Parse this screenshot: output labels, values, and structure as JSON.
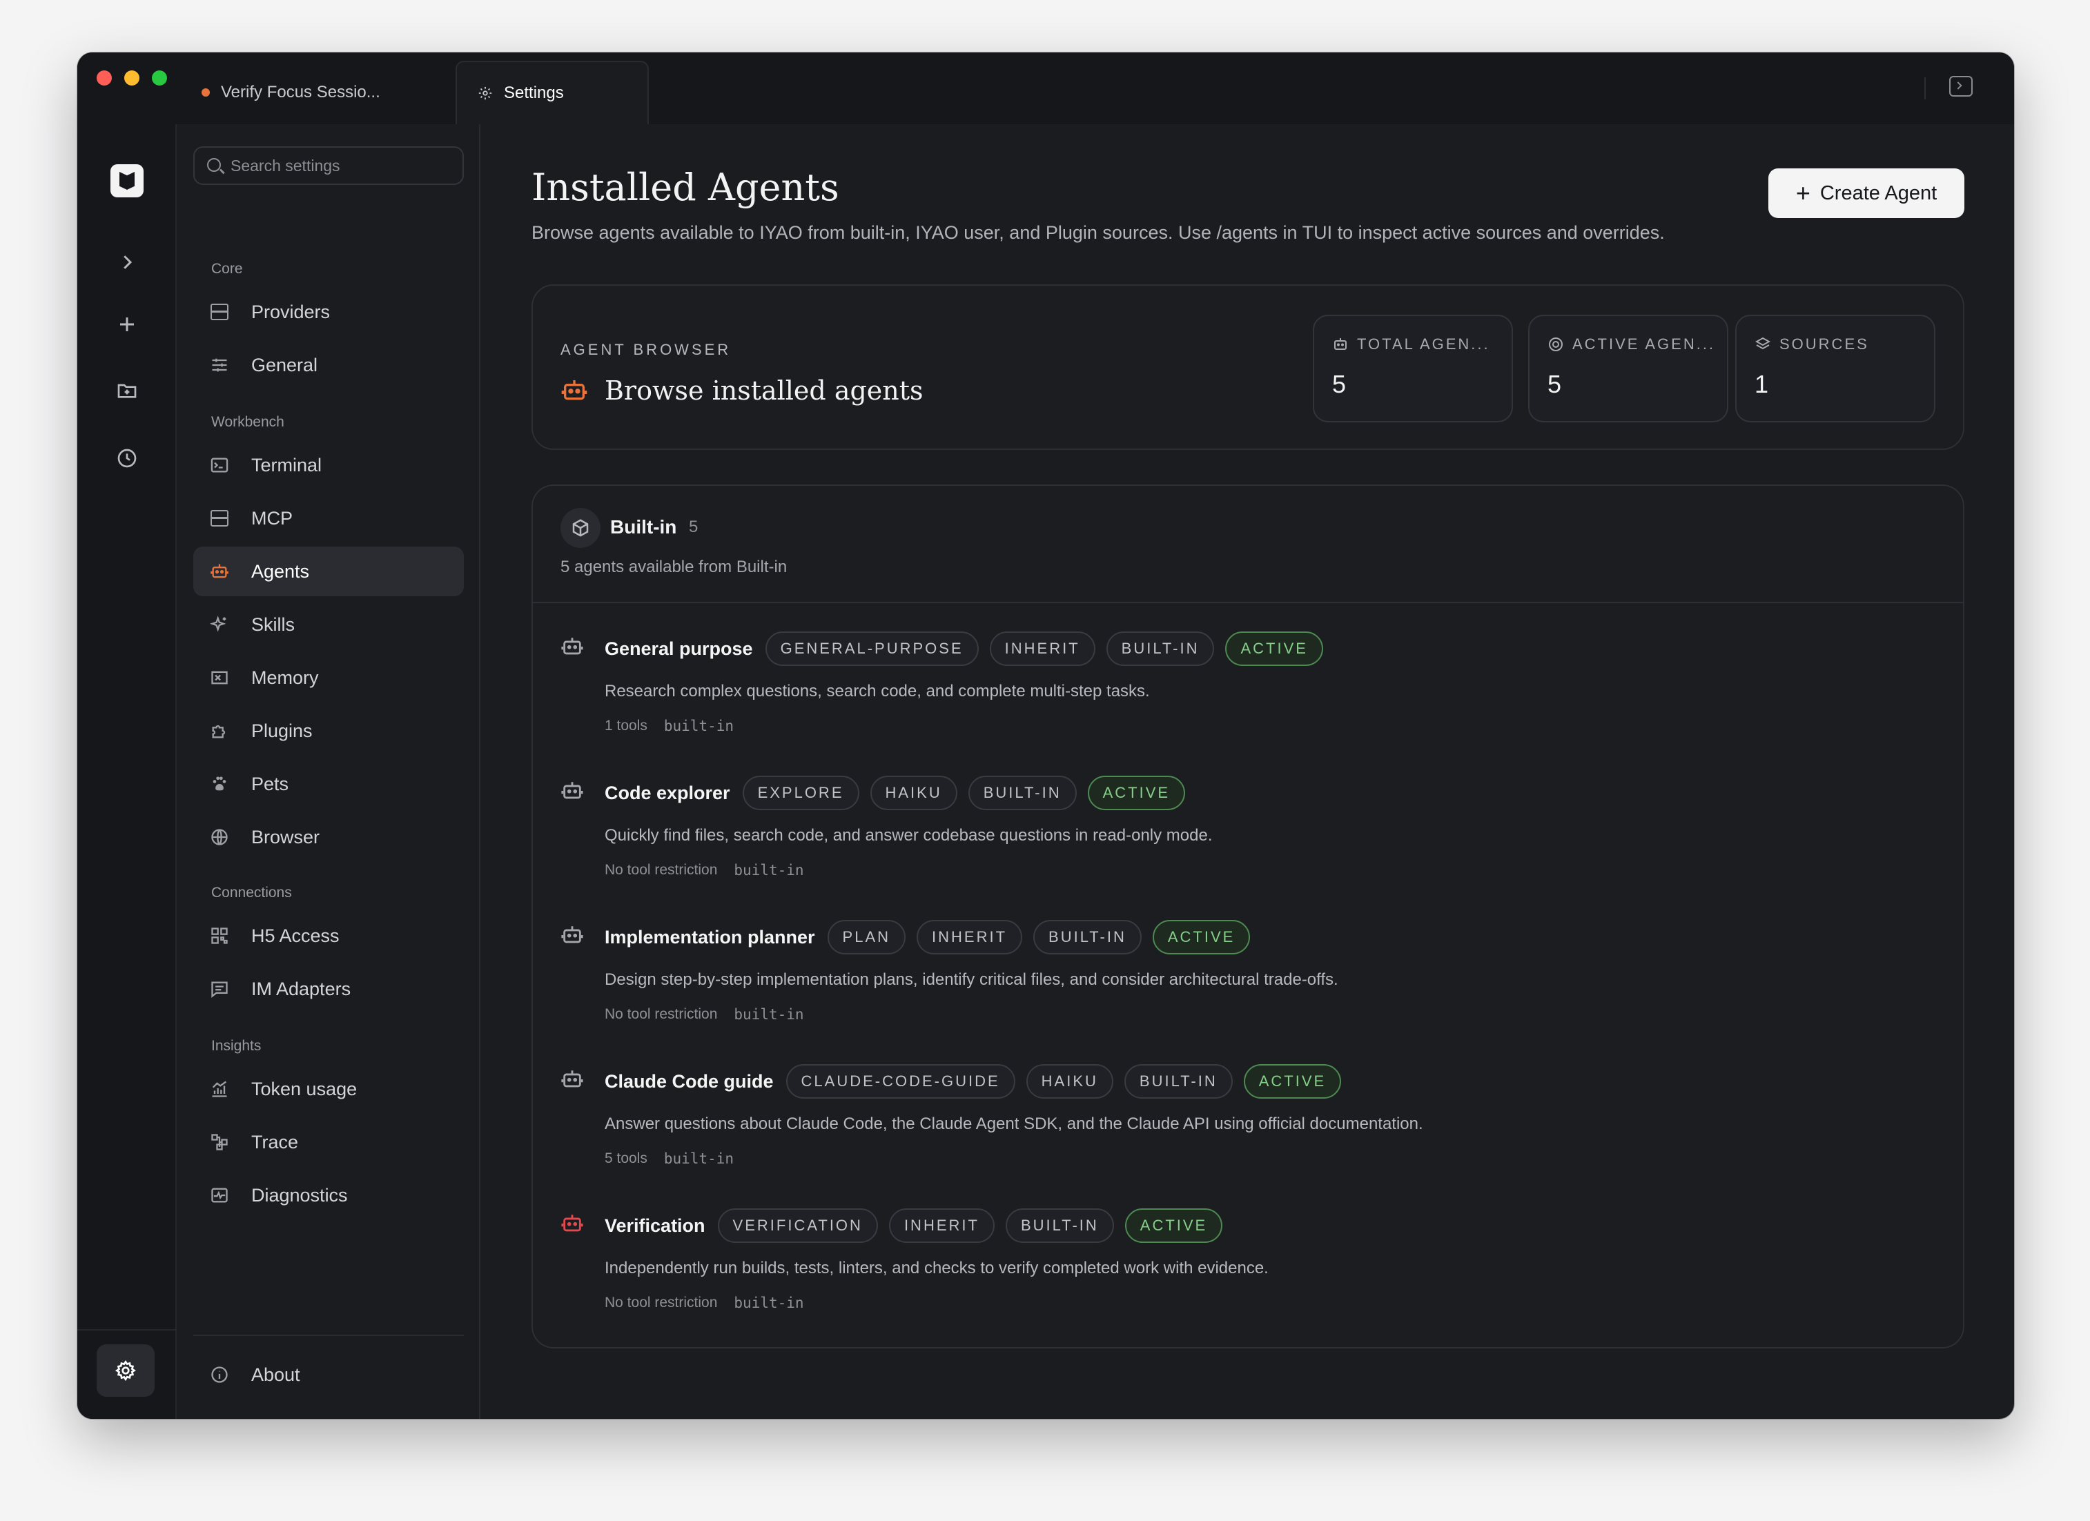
{
  "titlebar": {
    "tabs": [
      {
        "label": "Verify Focus Sessio..."
      },
      {
        "label": "Settings"
      }
    ]
  },
  "search": {
    "placeholder": "Search settings"
  },
  "sidebar": {
    "groups": [
      {
        "label": "Core",
        "items": [
          {
            "label": "Providers",
            "icon": "server-icon"
          },
          {
            "label": "General",
            "icon": "sliders-icon"
          }
        ]
      },
      {
        "label": "Workbench",
        "items": [
          {
            "label": "Terminal",
            "icon": "terminal-icon"
          },
          {
            "label": "MCP",
            "icon": "server-icon"
          },
          {
            "label": "Agents",
            "icon": "robot-icon",
            "active": true
          },
          {
            "label": "Skills",
            "icon": "sparkles-icon"
          },
          {
            "label": "Memory",
            "icon": "memory-icon"
          },
          {
            "label": "Plugins",
            "icon": "puzzle-icon"
          },
          {
            "label": "Pets",
            "icon": "paw-icon"
          },
          {
            "label": "Browser",
            "icon": "globe-icon"
          }
        ]
      },
      {
        "label": "Connections",
        "items": [
          {
            "label": "H5 Access",
            "icon": "qr-icon"
          },
          {
            "label": "IM Adapters",
            "icon": "chat-icon"
          }
        ]
      },
      {
        "label": "Insights",
        "items": [
          {
            "label": "Token usage",
            "icon": "chart-icon"
          },
          {
            "label": "Trace",
            "icon": "trace-icon"
          },
          {
            "label": "Diagnostics",
            "icon": "pulse-icon"
          }
        ]
      }
    ],
    "about": "About"
  },
  "main": {
    "title": "Installed Agents",
    "subtitle": "Browse agents available to IYAO from built-in, IYAO user, and Plugin sources. Use /agents in TUI to inspect active sources and overrides.",
    "create_label": "Create Agent",
    "browser": {
      "eyebrow": "AGENT BROWSER",
      "title": "Browse installed agents",
      "stats": [
        {
          "label": "TOTAL AGEN...",
          "value": "5",
          "icon": "robot-icon"
        },
        {
          "label": "ACTIVE AGEN...",
          "value": "5",
          "icon": "target-icon"
        },
        {
          "label": "SOURCES",
          "value": "1",
          "icon": "layers-icon"
        }
      ]
    },
    "builtin": {
      "title": "Built-in",
      "count": "5",
      "subtitle": "5 agents available from Built-in",
      "agents": [
        {
          "name": "General purpose",
          "tags": [
            "GENERAL-PURPOSE",
            "INHERIT",
            "BUILT-IN"
          ],
          "status": "ACTIVE",
          "description": "Research complex questions, search code, and complete multi-step tasks.",
          "tools": "1 tools",
          "source": "built-in"
        },
        {
          "name": "Code explorer",
          "tags": [
            "EXPLORE",
            "HAIKU",
            "BUILT-IN"
          ],
          "status": "ACTIVE",
          "description": "Quickly find files, search code, and answer codebase questions in read-only mode.",
          "tools": "No tool restriction",
          "source": "built-in"
        },
        {
          "name": "Implementation planner",
          "tags": [
            "PLAN",
            "INHERIT",
            "BUILT-IN"
          ],
          "status": "ACTIVE",
          "description": "Design step-by-step implementation plans, identify critical files, and consider architectural trade-offs.",
          "tools": "No tool restriction",
          "source": "built-in"
        },
        {
          "name": "Claude Code guide",
          "tags": [
            "CLAUDE-CODE-GUIDE",
            "HAIKU",
            "BUILT-IN"
          ],
          "status": "ACTIVE",
          "description": "Answer questions about Claude Code, the Claude Agent SDK, and the Claude API using official documentation.",
          "tools": "5 tools",
          "source": "built-in"
        },
        {
          "name": "Verification",
          "tags": [
            "VERIFICATION",
            "INHERIT",
            "BUILT-IN"
          ],
          "status": "ACTIVE",
          "description": "Independently run builds, tests, linters, and checks to verify completed work with evidence.",
          "tools": "No tool restriction",
          "source": "built-in",
          "icon_color": "#e5484d"
        }
      ]
    }
  },
  "colors": {
    "accent": "#e8743b",
    "active_green": "#86cf89",
    "danger": "#e5484d"
  }
}
